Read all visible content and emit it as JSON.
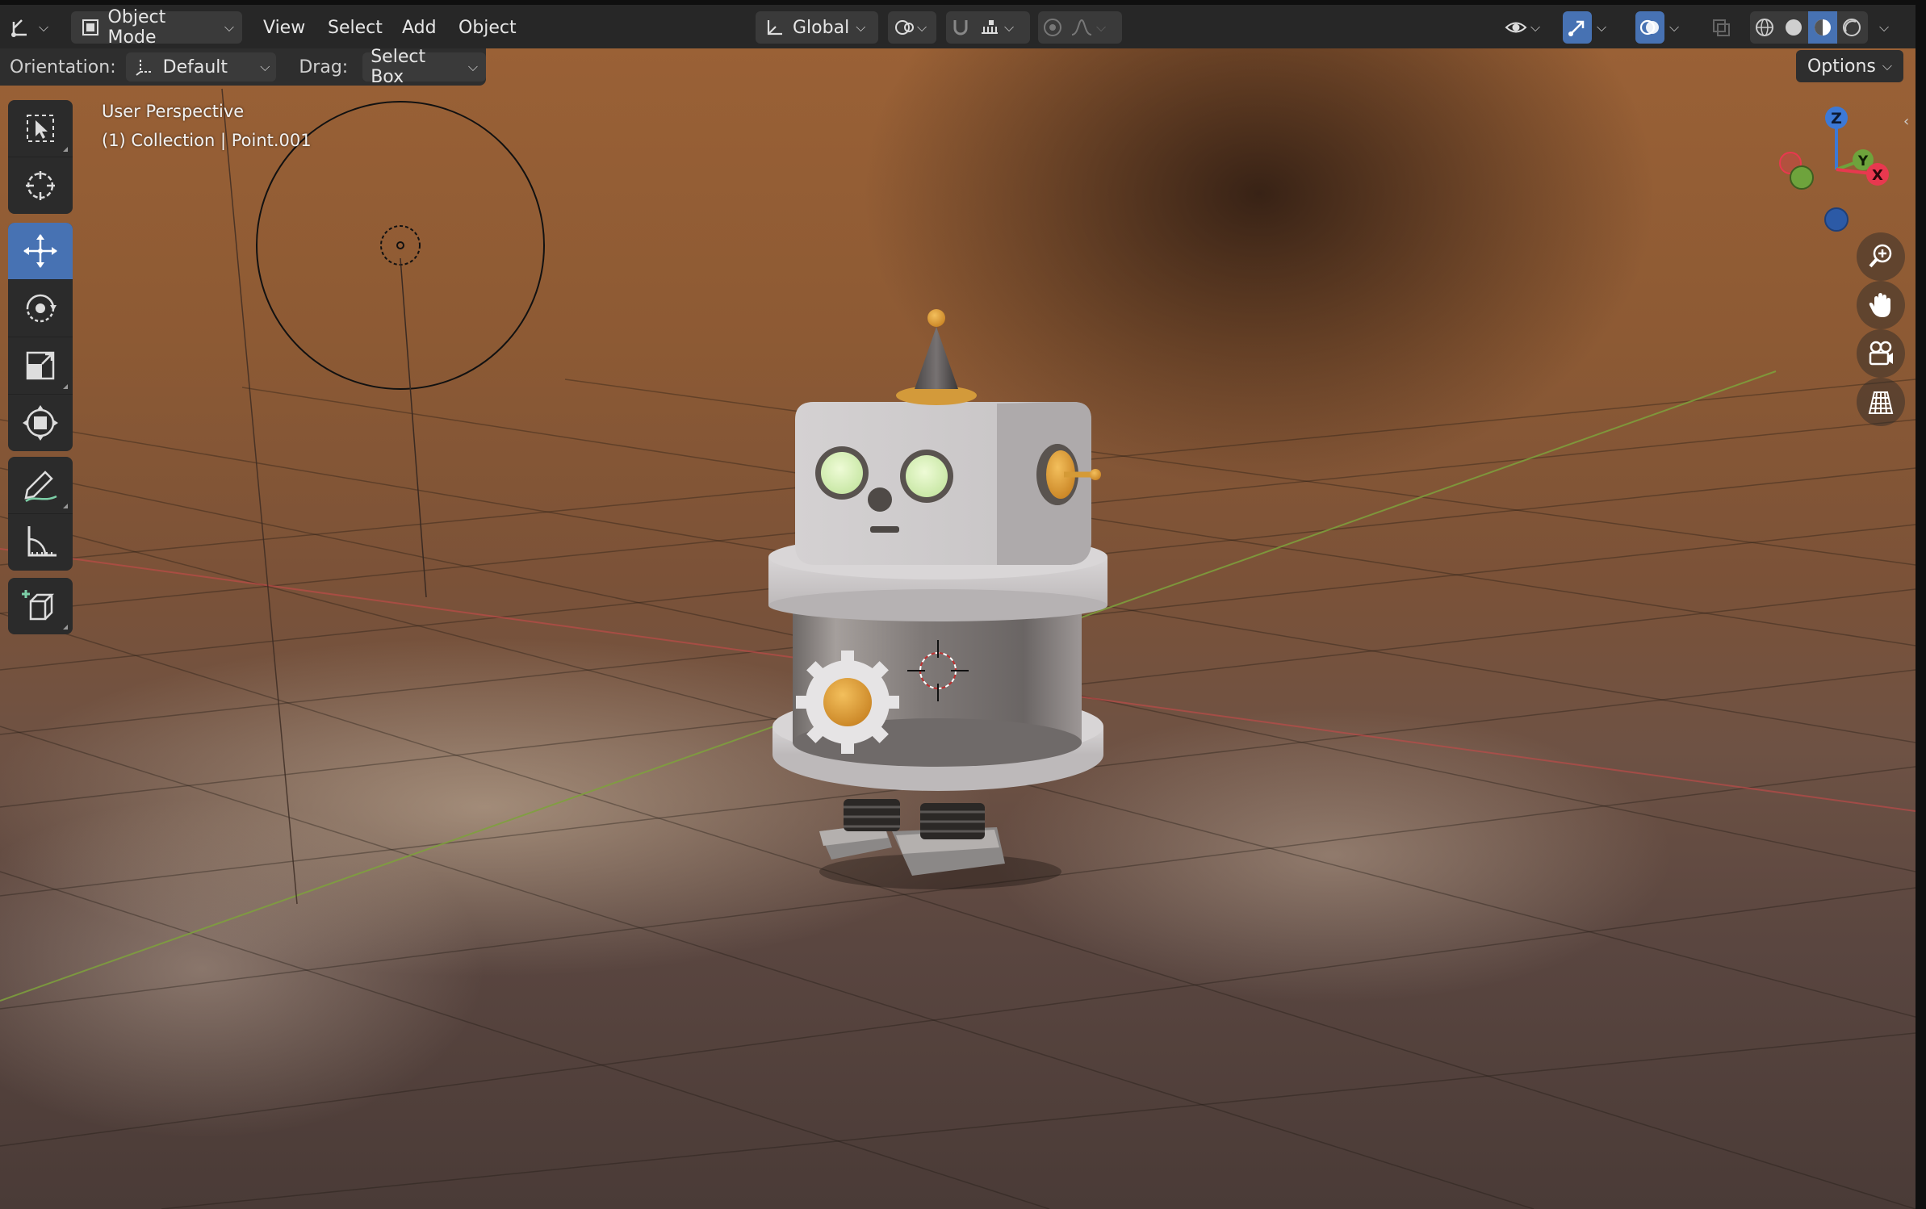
{
  "header": {
    "editor_type_icon": "transform-axes-icon",
    "mode": {
      "label": "Object Mode",
      "icon": "object-mode-icon"
    },
    "menus": [
      "View",
      "Select",
      "Add",
      "Object"
    ],
    "transform_orientation": {
      "label": "Global",
      "icon": "orientation-axes-icon"
    },
    "pivot_icon": "pivot-point-icon",
    "snap_icon": "snap-magnet-icon",
    "snap_target_icon": "snap-increment-icon",
    "proportional_icon": "proportional-edit-icon",
    "falloff_icon": "falloff-curve-icon",
    "visibility_icon": "eye-icon",
    "gizmo_icon": "gizmo-arrow-icon",
    "overlay_icon": "overlay-circles-icon",
    "xray_icon": "xray-icon",
    "shading_modes": [
      "wireframe-icon",
      "solid-icon",
      "material-preview-icon",
      "rendered-icon"
    ],
    "active_shading": "material-preview-icon"
  },
  "tool_settings": {
    "orientation_label": "Orientation:",
    "orientation_value": "Default",
    "drag_label": "Drag:",
    "drag_value": "Select Box",
    "options_label": "Options"
  },
  "toolbar": {
    "tools": [
      "select-box-icon",
      "cursor-icon",
      "move-icon",
      "rotate-icon",
      "scale-icon",
      "transform-icon",
      "annotate-icon",
      "measure-icon",
      "add-cube-icon"
    ],
    "active_tool": "move-icon"
  },
  "viewport": {
    "view_name": "User Perspective",
    "collection_info": "(1) Collection | Point.001"
  },
  "nav_gizmo": {
    "axes": [
      "Z",
      "Y",
      "X"
    ],
    "colors": {
      "x": "#e8384f",
      "y": "#6ea33c",
      "z": "#3c79d6"
    },
    "buttons": [
      "zoom-icon",
      "pan-hand-icon",
      "camera-view-icon",
      "ortho-grid-icon"
    ]
  },
  "colors": {
    "accent": "#4772b3",
    "header_bg": "#272727",
    "robot_orange": "#e3a23a",
    "eye_green": "#d8f4b0"
  }
}
